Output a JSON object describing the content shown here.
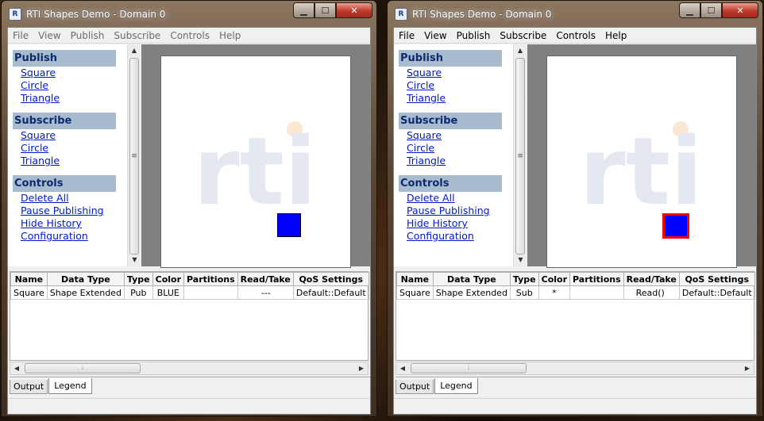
{
  "windows": [
    {
      "title": "RTI Shapes Demo - Domain 0",
      "menu": [
        {
          "label": "File",
          "dim": true
        },
        {
          "label": "View",
          "dim": true
        },
        {
          "label": "Publish",
          "dim": true
        },
        {
          "label": "Subscribe",
          "dim": true
        },
        {
          "label": "Controls",
          "dim": true
        },
        {
          "label": "Help",
          "dim": true
        }
      ],
      "sections": [
        {
          "title": "Publish",
          "links": [
            "Square",
            "Circle",
            "Triangle"
          ]
        },
        {
          "title": "Subscribe",
          "links": [
            "Square",
            "Circle",
            "Triangle"
          ]
        },
        {
          "title": "Controls",
          "links": [
            "Delete All",
            "Pause Publishing",
            "Hide History",
            "Configuration"
          ]
        }
      ],
      "logo_text": "rti",
      "shape": {
        "type": "Square",
        "fill": "#0000ff",
        "border": "#000000"
      },
      "table": {
        "headers": [
          "Name",
          "Data Type",
          "Type",
          "Color",
          "Partitions",
          "Read/Take",
          "QoS Settings"
        ],
        "rows": [
          [
            "Square",
            "Shape Extended",
            "Pub",
            "BLUE",
            "",
            "---",
            "Default::Default"
          ]
        ]
      },
      "tabs": [
        "Output",
        "Legend"
      ],
      "active_tab": "Legend"
    },
    {
      "title": "RTI Shapes Demo - Domain 0",
      "menu": [
        {
          "label": "File",
          "dim": false
        },
        {
          "label": "View",
          "dim": false
        },
        {
          "label": "Publish",
          "dim": false
        },
        {
          "label": "Subscribe",
          "dim": false
        },
        {
          "label": "Controls",
          "dim": false
        },
        {
          "label": "Help",
          "dim": false
        }
      ],
      "sections": [
        {
          "title": "Publish",
          "links": [
            "Square",
            "Circle",
            "Triangle"
          ]
        },
        {
          "title": "Subscribe",
          "links": [
            "Square",
            "Circle",
            "Triangle"
          ]
        },
        {
          "title": "Controls",
          "links": [
            "Delete All",
            "Pause Publishing",
            "Hide History",
            "Configuration"
          ]
        }
      ],
      "logo_text": "rti",
      "shape": {
        "type": "Square",
        "fill": "#0000ff",
        "border": "#ff0000"
      },
      "table": {
        "headers": [
          "Name",
          "Data Type",
          "Type",
          "Color",
          "Partitions",
          "Read/Take",
          "QoS Settings"
        ],
        "rows": [
          [
            "Square",
            "Shape Extended",
            "Sub",
            "*",
            "",
            "Read()",
            "Default::Default"
          ]
        ]
      },
      "tabs": [
        "Output",
        "Legend"
      ],
      "active_tab": "Legend"
    }
  ]
}
